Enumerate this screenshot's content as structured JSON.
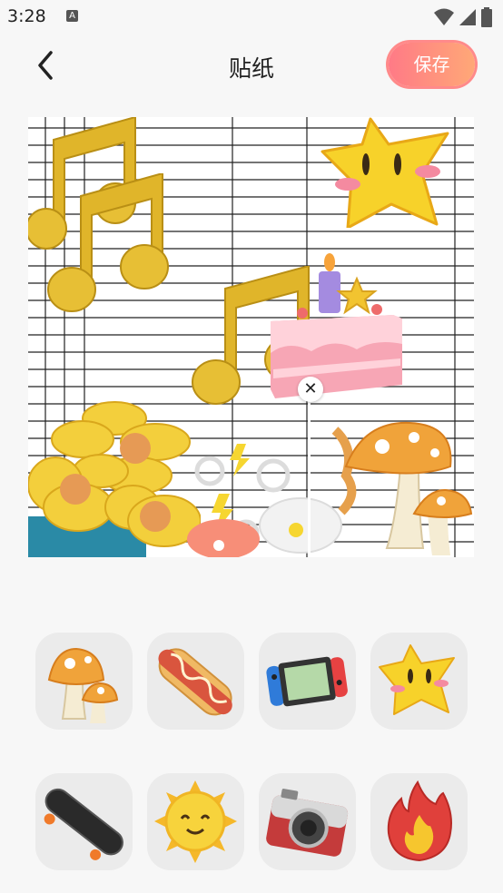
{
  "status": {
    "time": "3:28",
    "badge": "A"
  },
  "header": {
    "title": "贴纸",
    "save_label": "保存"
  },
  "canvas": {
    "stickers": [
      "music-note-icon",
      "music-note-icon",
      "music-note-icon",
      "star-icon",
      "cake-icon",
      "flowers-icon",
      "sparkle-flowers-icon",
      "mushroom-icon"
    ]
  },
  "palette": [
    "mushroom-icon",
    "hotdog-icon",
    "game-console-icon",
    "star-icon",
    "skateboard-icon",
    "sun-icon",
    "camera-icon",
    "flame-icon"
  ],
  "colors": {
    "accent": "#ff8a8a",
    "note": "#e8c23a",
    "star": "#f7d22a"
  }
}
